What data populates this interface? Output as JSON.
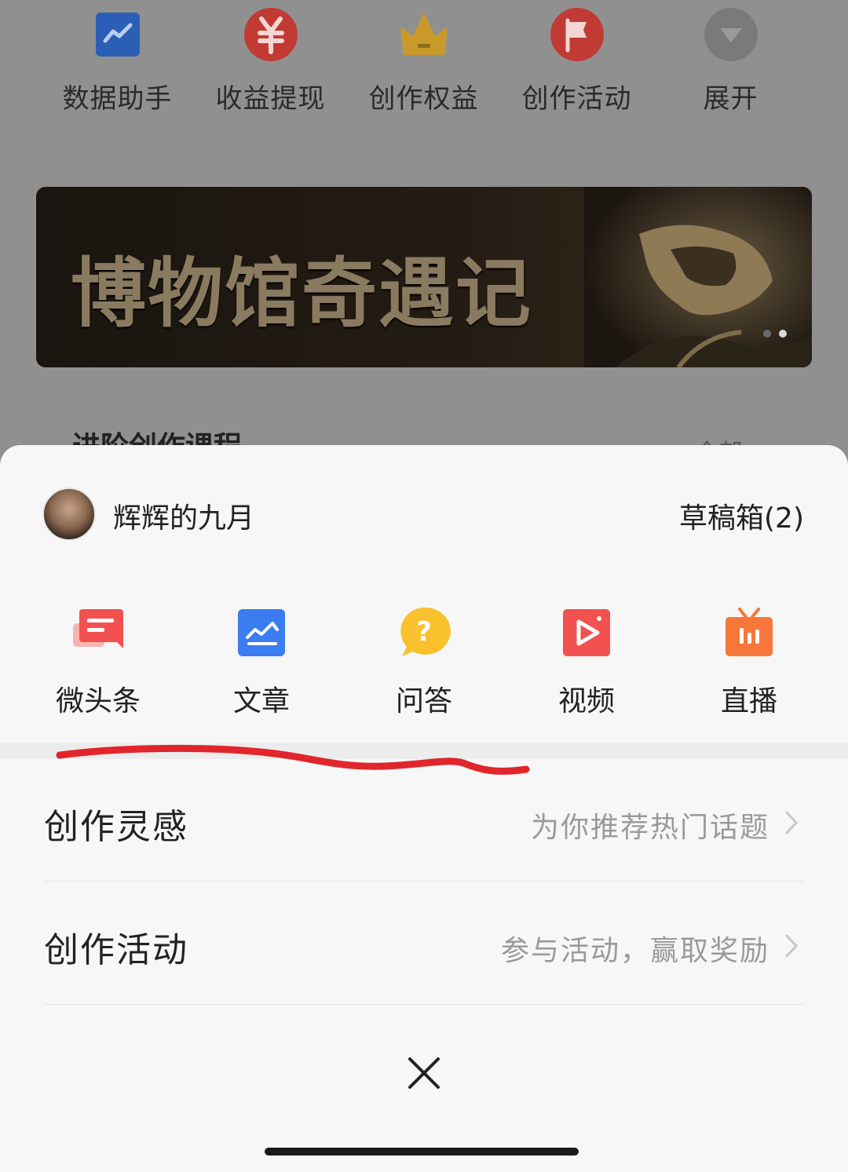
{
  "background": {
    "tools": [
      {
        "label": "数据助手",
        "icon": "chart-icon",
        "color": "#2f6fd6"
      },
      {
        "label": "收益提现",
        "icon": "yuan-icon",
        "color": "#e23b35"
      },
      {
        "label": "创作权益",
        "icon": "crown-icon",
        "color": "#e8b32c"
      },
      {
        "label": "创作活动",
        "icon": "flag-icon",
        "color": "#e23b35"
      },
      {
        "label": "展开",
        "icon": "expand-icon",
        "color": "#8a8a8a"
      }
    ],
    "banner_title": "博物馆奇遇记",
    "peek_title": "进阶创作课程",
    "peek_more": "全部 >"
  },
  "sheet": {
    "username": "辉辉的九月",
    "drafts": "草稿箱(2)",
    "create_items": [
      {
        "label": "微头条",
        "icon": "micro-post-icon",
        "color": "#f2514f"
      },
      {
        "label": "文章",
        "icon": "article-icon",
        "color": "#3b7cf0"
      },
      {
        "label": "问答",
        "icon": "qa-icon",
        "color": "#f8c12d"
      },
      {
        "label": "视频",
        "icon": "video-icon",
        "color": "#f2514f"
      },
      {
        "label": "直播",
        "icon": "live-icon",
        "color": "#f7773a"
      }
    ],
    "rows": [
      {
        "title": "创作灵感",
        "subtitle": "为你推荐热门话题"
      },
      {
        "title": "创作活动",
        "subtitle": "参与活动，赢取奖励"
      }
    ],
    "annotation_color": "#e0262c"
  }
}
